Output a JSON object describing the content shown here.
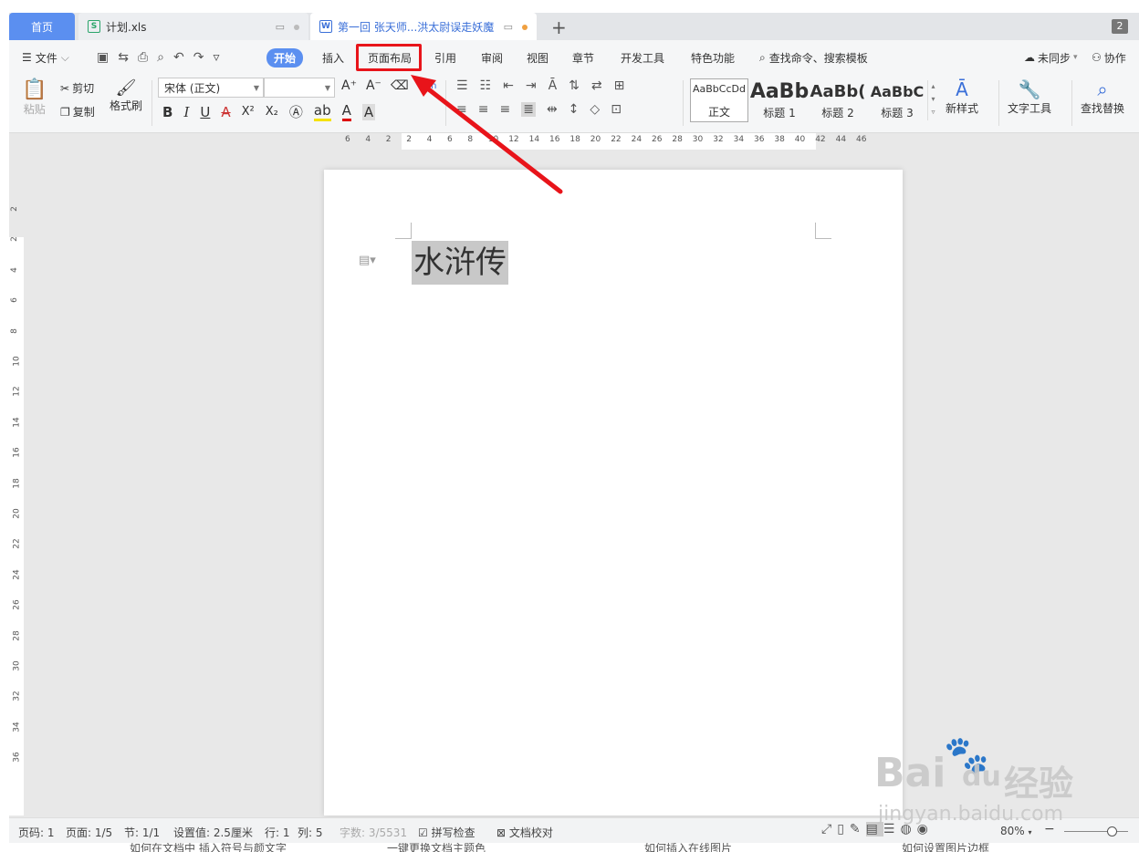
{
  "tabs": {
    "home": "首页",
    "xls": "计划.xls",
    "doc": "第一回 张天师...洪太尉误走妖魔",
    "add": "+",
    "window_count": "2"
  },
  "menu": {
    "file": "文件",
    "start": "开始",
    "insert": "插入",
    "layout": "页面布局",
    "reference": "引用",
    "review": "审阅",
    "view": "视图",
    "chapter": "章节",
    "devtools": "开发工具",
    "special": "特色功能",
    "search": "查找命令、搜索模板",
    "sync": "未同步",
    "collab": "协作"
  },
  "ribbon": {
    "paste": "粘贴",
    "cut": "剪切",
    "copy": "复制",
    "format_painter": "格式刷",
    "font_name": "宋体 (正文)",
    "font_size": "",
    "style_normal_preview": "AaBbCcDd",
    "style_normal": "正文",
    "style_h1_preview": "AaBb",
    "style_h1": "标题 1",
    "style_h2_preview": "AaBb(",
    "style_h2": "标题 2",
    "style_h3_preview": "AaBbC",
    "style_h3": "标题 3",
    "new_style": "新样式",
    "text_tools": "文字工具",
    "find_replace": "查找替换",
    "bold": "B",
    "italic": "I",
    "underline": "U",
    "strike": "A",
    "superscript": "X²",
    "subscript": "X₂",
    "pinyin": "wén"
  },
  "ruler": {
    "h_ticks": [
      "6",
      "4",
      "2",
      "2",
      "4",
      "6",
      "8",
      "10",
      "12",
      "14",
      "16",
      "18",
      "20",
      "22",
      "24",
      "26",
      "28",
      "30",
      "32",
      "34",
      "36",
      "38",
      "40",
      "42",
      "44",
      "46"
    ],
    "v_ticks": [
      "2",
      "2",
      "4",
      "6",
      "8",
      "10",
      "12",
      "14",
      "16",
      "18",
      "20",
      "22",
      "24",
      "26",
      "28",
      "30",
      "32",
      "34",
      "36"
    ]
  },
  "document": {
    "title": "水浒传"
  },
  "status": {
    "page_num": "页码: 1",
    "pages": "页面: 1/5",
    "section": "节: 1/1",
    "setting": "设置值: 2.5厘米",
    "row": "行: 1",
    "col": "列: 5",
    "wordcount": "字数: 3/5531",
    "spellcheck": "拼写检查",
    "proofread": "文档校对",
    "zoom": "80%"
  },
  "bottom_links": [
    "如何在文档中 插入符号与颜文字",
    "一键更换文档主题色",
    "如何插入在线图片",
    "如何设置图片边框"
  ],
  "watermark": {
    "brand": "Bai",
    "du": "du",
    "jingyan": "经验",
    "url": "jingyan.baidu.com"
  },
  "colors": {
    "accent": "#5b8ff0",
    "annotation": "#e8141a"
  }
}
